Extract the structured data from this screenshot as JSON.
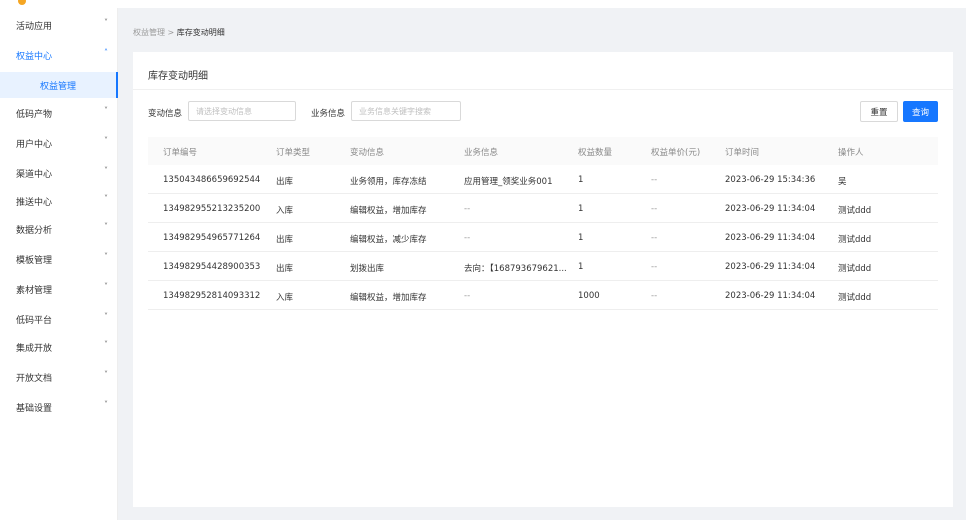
{
  "sidebar": {
    "items": [
      {
        "label": "活动应用",
        "open": false
      },
      {
        "label": "权益中心",
        "open": true
      },
      {
        "label": "低码产物",
        "open": false
      },
      {
        "label": "用户中心",
        "open": false
      },
      {
        "label": "渠道中心",
        "open": false
      },
      {
        "label": "推送中心",
        "open": false
      },
      {
        "label": "数据分析",
        "open": false
      },
      {
        "label": "模板管理",
        "open": false
      },
      {
        "label": "素材管理",
        "open": false
      },
      {
        "label": "低码平台",
        "open": false
      },
      {
        "label": "集成开放",
        "open": false
      },
      {
        "label": "开放文档",
        "open": false
      },
      {
        "label": "基础设置",
        "open": false
      }
    ],
    "submenu_active": "权益管理",
    "chevron_down": "˅",
    "chevron_up": "˄"
  },
  "breadcrumb": {
    "parent": "权益管理",
    "separator": ">",
    "current": "库存变动明细"
  },
  "panel": {
    "title": "库存变动明细"
  },
  "filters": {
    "change_label": "变动信息",
    "change_placeholder": "请选择变动信息",
    "business_label": "业务信息",
    "business_placeholder": "业务信息关键字搜索",
    "reset_label": "重置",
    "query_label": "查询"
  },
  "table": {
    "columns": [
      "订单编号",
      "订单类型",
      "变动信息",
      "业务信息",
      "权益数量",
      "权益单价(元)",
      "订单时间",
      "操作人"
    ],
    "rows": [
      [
        "135043486659692544",
        "出库",
        "业务领用，库存冻结",
        "应用管理_领奖业务001",
        "1",
        "--",
        "2023-06-29 15:34:36",
        "吴"
      ],
      [
        "134982955213235200",
        "入库",
        "编辑权益，增加库存",
        "--",
        "1",
        "--",
        "2023-06-29 11:34:04",
        "测试ddd"
      ],
      [
        "134982954965771264",
        "出库",
        "编辑权益，减少库存",
        "--",
        "1",
        "--",
        "2023-06-29 11:34:04",
        "测试ddd"
      ],
      [
        "134982954428900353",
        "出库",
        "划拨出库",
        "去向：【168793679621...",
        "1",
        "--",
        "2023-06-29 11:34:04",
        "测试ddd"
      ],
      [
        "134982952814093312",
        "入库",
        "编辑权益，增加库存",
        "--",
        "1000",
        "--",
        "2023-06-29 11:34:04",
        "测试ddd"
      ]
    ]
  },
  "colors": {
    "accent": "#1677ff",
    "page_bg": "#f0f2f5"
  }
}
